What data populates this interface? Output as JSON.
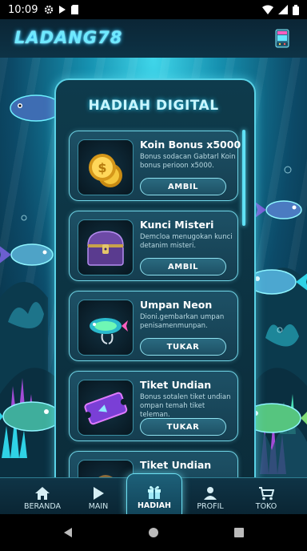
{
  "status": {
    "time": "10:09"
  },
  "header": {
    "logo": "LADANG78",
    "arcade_icon": "arcade-machine-icon"
  },
  "panel": {
    "title": "HADIAH DIGITAL"
  },
  "cards": [
    {
      "title": "Koin Bonus x5000",
      "desc": "Bonus sodacan Gabtarl Koin bonus perioon x5000.",
      "button": "AMBIL",
      "icon": "gold-coins-icon"
    },
    {
      "title": "Kunci Misteri",
      "desc": "Demcloa menugokan kunci detanim misteri.",
      "button": "AMBIL",
      "icon": "treasure-chest-icon"
    },
    {
      "title": "Umpan Neon",
      "desc": "Dioni.gembarkan umpan penisamenmunpan.",
      "button": "TUKAR",
      "icon": "neon-lure-icon"
    },
    {
      "title": "Tiket Undian",
      "desc": "Bonus sotalen tiket undian ompan temah tiket teleman.",
      "button": "TUKAR",
      "icon": "ticket-icon"
    },
    {
      "title": "Tiket Undian",
      "icon": "box-icon"
    }
  ],
  "nav": [
    {
      "label": "BERANDA",
      "icon": "home-icon"
    },
    {
      "label": "MAIN",
      "icon": "play-icon"
    },
    {
      "label": "HADIAH",
      "icon": "gift-icon",
      "active": true
    },
    {
      "label": "PROFIL",
      "icon": "profile-icon"
    },
    {
      "label": "TOKO",
      "icon": "cart-icon"
    }
  ]
}
